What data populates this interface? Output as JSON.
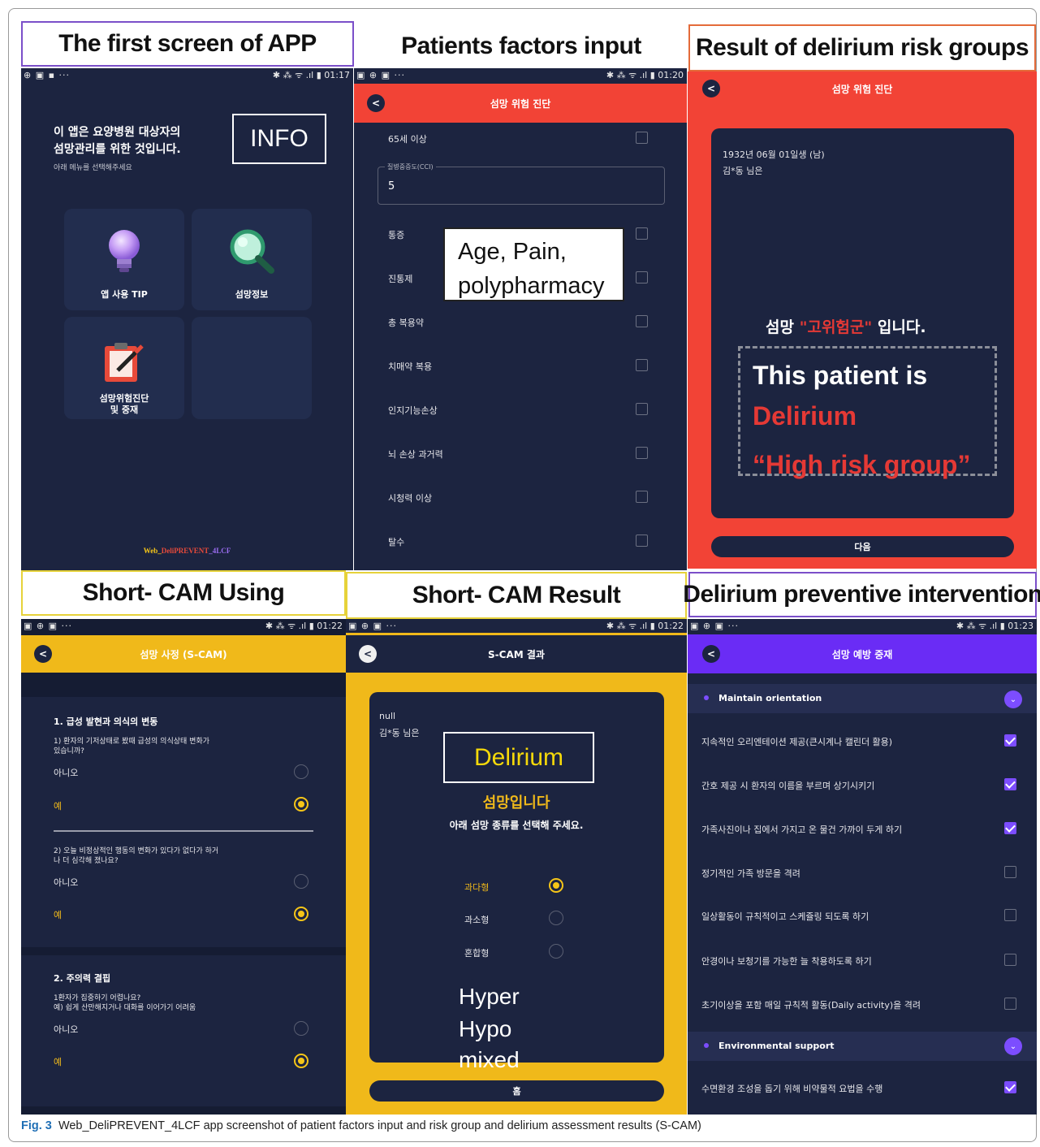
{
  "labels": {
    "first_screen": "The first screen of APP",
    "patients_factors": "Patients factors input",
    "risk_result": "Result of delirium risk groups",
    "scam_using": "Short- CAM Using",
    "scam_result": "Short- CAM Result",
    "intervention": "Delirium preventive intervention"
  },
  "status_bars": [
    {
      "icons_left": "⊕ ▣ ▪ ···",
      "icons_right": "✱ ⁂ ᯤ .ıl ▮",
      "time": "01:17"
    },
    {
      "icons_left": "▣ ⊕ ▣ ···",
      "icons_right": "✱ ⁂ ᯤ .ıl ▮",
      "time": "01:20"
    },
    {
      "icons_left": "▣ ⊕ ▣ ···",
      "icons_right": "✱ ⁂ ᯤ .ıl ▮",
      "time": "01:22"
    },
    {
      "icons_left": "▣ ⊕ ▣ ···",
      "icons_right": "✱ ⁂ ᯤ .ıl ▮",
      "time": "01:22"
    },
    {
      "icons_left": "▣ ⊕ ▣ ···",
      "icons_right": "✱ ⁂ ᯤ .ıl ▮",
      "time": "01:23"
    }
  ],
  "screen1": {
    "intro_line1": "이 앱은 요양병원 대상자의",
    "intro_line2": "섬망관리를 위한 것입니다.",
    "intro_sub": "아래 메뉴를 선택해주세요",
    "info_annotation": "INFO",
    "tiles": [
      {
        "label": "앱 사용 TIP",
        "icon": "lightbulb-icon"
      },
      {
        "label": "섬망정보",
        "icon": "magnifier-icon"
      },
      {
        "label_line1": "섬망위험진단",
        "label_line2": "및 중재",
        "icon": "clipboard-icon"
      }
    ],
    "footer_parts": [
      "Web_",
      "DeliPREVENT",
      "_4LCF"
    ],
    "colors": {
      "bg": "#1c2440",
      "tile": "#222d4e"
    }
  },
  "screen2": {
    "title": "섬망 위험 진단",
    "header_color": "#f24336",
    "age_item": "65세 이상",
    "cci_label": "질병중증도(CCI)",
    "cci_value": "5",
    "items": [
      "통증",
      "진통제",
      "총 복용약",
      "치매약 복용",
      "인지기능손상",
      "뇌 손상 과거력",
      "시청력 이상",
      "탈수"
    ],
    "annotation_line1": "Age, Pain,",
    "annotation_line2": "polypharmacy"
  },
  "screen3": {
    "title": "섬망 위험 진단",
    "patient_dob": "1932년 06월 01일생 (남)",
    "patient_name": "김*동 님은",
    "result_prefix": "섬망 ",
    "result_group": "\"고위험군\"",
    "result_suffix": " 입니다.",
    "annotation_line1": "This patient is",
    "annotation_line2": "Delirium",
    "annotation_line3": "“High risk group”",
    "next_button": "다음",
    "colors": {
      "bg": "#f24336",
      "card": "#1c2440",
      "highlight": "#e53935"
    }
  },
  "screen4": {
    "title": "섬망 사정 (S-CAM)",
    "header_color": "#f0b91a",
    "section1_title": "1. 급성 발현과 의식의 변동",
    "q1_line1": "1) 환자의 기저상태로 봤때 급성의 의식상태 변화가",
    "q1_line2": "있습니까?",
    "q2_line1": "2) 오늘 비정상적인 행동의 변화가 있다가 없다가 하거",
    "q2_line2": "나 더 심각해 졌나요?",
    "section2_title": "2. 주의력 결핍",
    "q3_line1": "1환자가 집중하기 어렵나요?",
    "q3_line2": "예) 쉽게 산만해지거나 대화를 이어가기 어려움",
    "no": "아니오",
    "yes": "예"
  },
  "screen5": {
    "title": "S-CAM 결과",
    "null_text": "null",
    "patient_name": "김*동 님은",
    "annotation_delirium": "Delirium",
    "result_text": "섬망입니다",
    "instruction": "아래 섬망 종류를 선택해 주세요.",
    "types": [
      "과다형",
      "과소형",
      "혼합형"
    ],
    "annotation_types": [
      "Hyper",
      "Hypo",
      "mixed"
    ],
    "home_button": "홈",
    "colors": {
      "bg": "#f0b91a",
      "card": "#1c2440"
    }
  },
  "screen6": {
    "title": "섬망 예방 중재",
    "header_color": "#6a2cf5",
    "section1": "Maintain orientation",
    "items": [
      {
        "text": "지속적인 오리엔테이션 제공(큰시계나 캘린더 활용)",
        "checked": true
      },
      {
        "text": "간호 제공 시 환자의 이름을 부르며 상기시키기",
        "checked": true
      },
      {
        "text": "가족사진이나 집에서 가지고 온 물건 가까이 두게 하기",
        "checked": true
      },
      {
        "text": "정기적인 가족 방문을 격려",
        "checked": false
      },
      {
        "text": "일상활동이 규칙적이고 스케쥴링 되도록 하기",
        "checked": false
      },
      {
        "text": "안경이나 보청기를 가능한 늘 착용하도록 하기",
        "checked": false
      },
      {
        "text": "초기이상을 포함 매일 규칙적 활동(Daily activity)을 격려",
        "checked": false
      }
    ],
    "section2": "Environmental support",
    "env_item": {
      "text": "수면환경 조성을 돕기 위해 비약물적 요법을 수행",
      "checked": true
    }
  },
  "caption": {
    "prefix": "Fig. 3",
    "text": "Web_DeliPREVENT_4LCF app screenshot of patient factors input and risk group and delirium assessment results (S-CAM)"
  }
}
